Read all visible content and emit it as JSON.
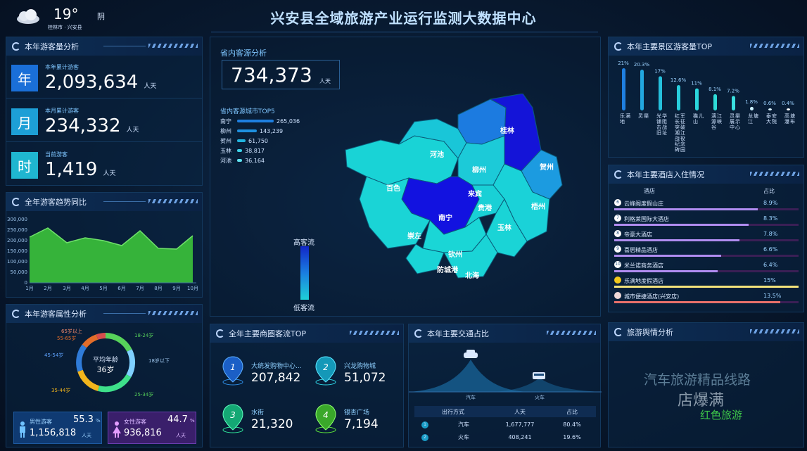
{
  "weather": {
    "temp": "19°",
    "cond": "阴",
    "loc": "桂林市 · 兴安县"
  },
  "title": "兴安县全域旅游产业运行监测大数据中心",
  "tourists": {
    "header": "本年游客量分析",
    "year": {
      "box": "年",
      "label": "本年累计游客",
      "value": "2,093,634",
      "unit": "人天"
    },
    "month": {
      "box": "月",
      "label": "本月累计游客",
      "value": "234,332",
      "unit": "人天"
    },
    "hour": {
      "box": "时",
      "label": "当前游客",
      "value": "1,419",
      "unit": "人天"
    }
  },
  "trend": {
    "header": "全年游客趋势同比",
    "ylabels": [
      "300,000",
      "250,000",
      "200,000",
      "150,000",
      "100,000",
      "50,000",
      "0"
    ]
  },
  "attr": {
    "header": "本年游客属性分析",
    "center_label": "平均年龄",
    "center_value": "36岁",
    "segments": [
      "65岁以上",
      "55-65岁",
      "45-54岁",
      "18-24岁",
      "18岁以下",
      "35-44岁",
      "25-34岁"
    ],
    "male": {
      "label": "男性游客",
      "pct": "55.3",
      "pct_unit": "%",
      "value": "1,156,818",
      "unit": "人天"
    },
    "female": {
      "label": "女性游客",
      "pct": "44.7",
      "pct_unit": "%",
      "value": "936,816",
      "unit": "人天"
    }
  },
  "source": {
    "header": "省内客源分析",
    "value": "734,373",
    "unit": "人天",
    "top_title": "省内客源城市TOP5",
    "cities": [
      {
        "name": "南宁",
        "value": "265,036"
      },
      {
        "name": "柳州",
        "value": "143,239"
      },
      {
        "name": "贺州",
        "value": "61,750"
      },
      {
        "name": "玉林",
        "value": "38,817"
      },
      {
        "name": "河池",
        "value": "36,164"
      }
    ],
    "legend_high": "高客流",
    "legend_low": "低客流",
    "map_labels": [
      "桂林",
      "河池",
      "柳州",
      "贺州",
      "百色",
      "来宾",
      "梧州",
      "南宁",
      "贵港",
      "玉林",
      "崇左",
      "钦州",
      "防城港",
      "北海"
    ]
  },
  "scenic": {
    "header": "本年主要景区游客量TOP",
    "items": [
      {
        "pct": "21%",
        "name": "乐满地"
      },
      {
        "pct": "20.3%",
        "name": "灵渠"
      },
      {
        "pct": "17%",
        "name": "光华铺阻击战旧址"
      },
      {
        "pct": "12.6%",
        "name": "红军长征突破湘江战役纪念碑园"
      },
      {
        "pct": "11%",
        "name": "猫儿山"
      },
      {
        "pct": "8.1%",
        "name": "漓江源峡谷"
      },
      {
        "pct": "7.2%",
        "name": "灵渠展示中心"
      },
      {
        "pct": "1.8%",
        "name": "龙塘江"
      },
      {
        "pct": "0.6%",
        "name": "泰安大院"
      },
      {
        "pct": "0.4%",
        "name": "高塘瀑布"
      }
    ]
  },
  "hotels": {
    "header": "本年主要酒店入住情况",
    "col_name": "酒店",
    "col_pct": "占比",
    "items": [
      {
        "rank": "6",
        "name": "云峰阁度假山庄",
        "pct": "8.9%"
      },
      {
        "rank": "7",
        "name": "利格莱国际大酒店",
        "pct": "8.3%"
      },
      {
        "rank": "8",
        "name": "帝豪大酒店",
        "pct": "7.8%"
      },
      {
        "rank": "9",
        "name": "喜居精品酒店",
        "pct": "6.6%"
      },
      {
        "rank": "10",
        "name": "米兰诺商务酒店",
        "pct": "6.4%"
      },
      {
        "rank": "",
        "name": "乐满地度假酒店",
        "pct": "15%"
      },
      {
        "rank": "",
        "name": "城市便捷酒店(兴安店)",
        "pct": "13.5%"
      }
    ]
  },
  "shops": {
    "header": "全年主要商圈客流TOP",
    "items": [
      {
        "rank": "1",
        "name": "大统发购物中心...",
        "value": "207,842"
      },
      {
        "rank": "2",
        "name": "兴龙购物城",
        "value": "51,072"
      },
      {
        "rank": "3",
        "name": "水街",
        "value": "21,320"
      },
      {
        "rank": "4",
        "name": "银杏广场",
        "value": "7,194"
      }
    ]
  },
  "traffic": {
    "header": "本年主要交通占比",
    "car": "汽车",
    "train": "火车",
    "col1": "出行方式",
    "col2": "人天",
    "col3": "占比",
    "rows": [
      {
        "n": "1",
        "mode": "汽车",
        "value": "1,677,777",
        "pct": "80.4%"
      },
      {
        "n": "2",
        "mode": "火车",
        "value": "408,241",
        "pct": "19.6%"
      }
    ]
  },
  "opinion": {
    "header": "旅游舆情分析",
    "w1": "汽车旅游精品线路",
    "w2": "店爆满",
    "w3": "红色旅游"
  }
}
